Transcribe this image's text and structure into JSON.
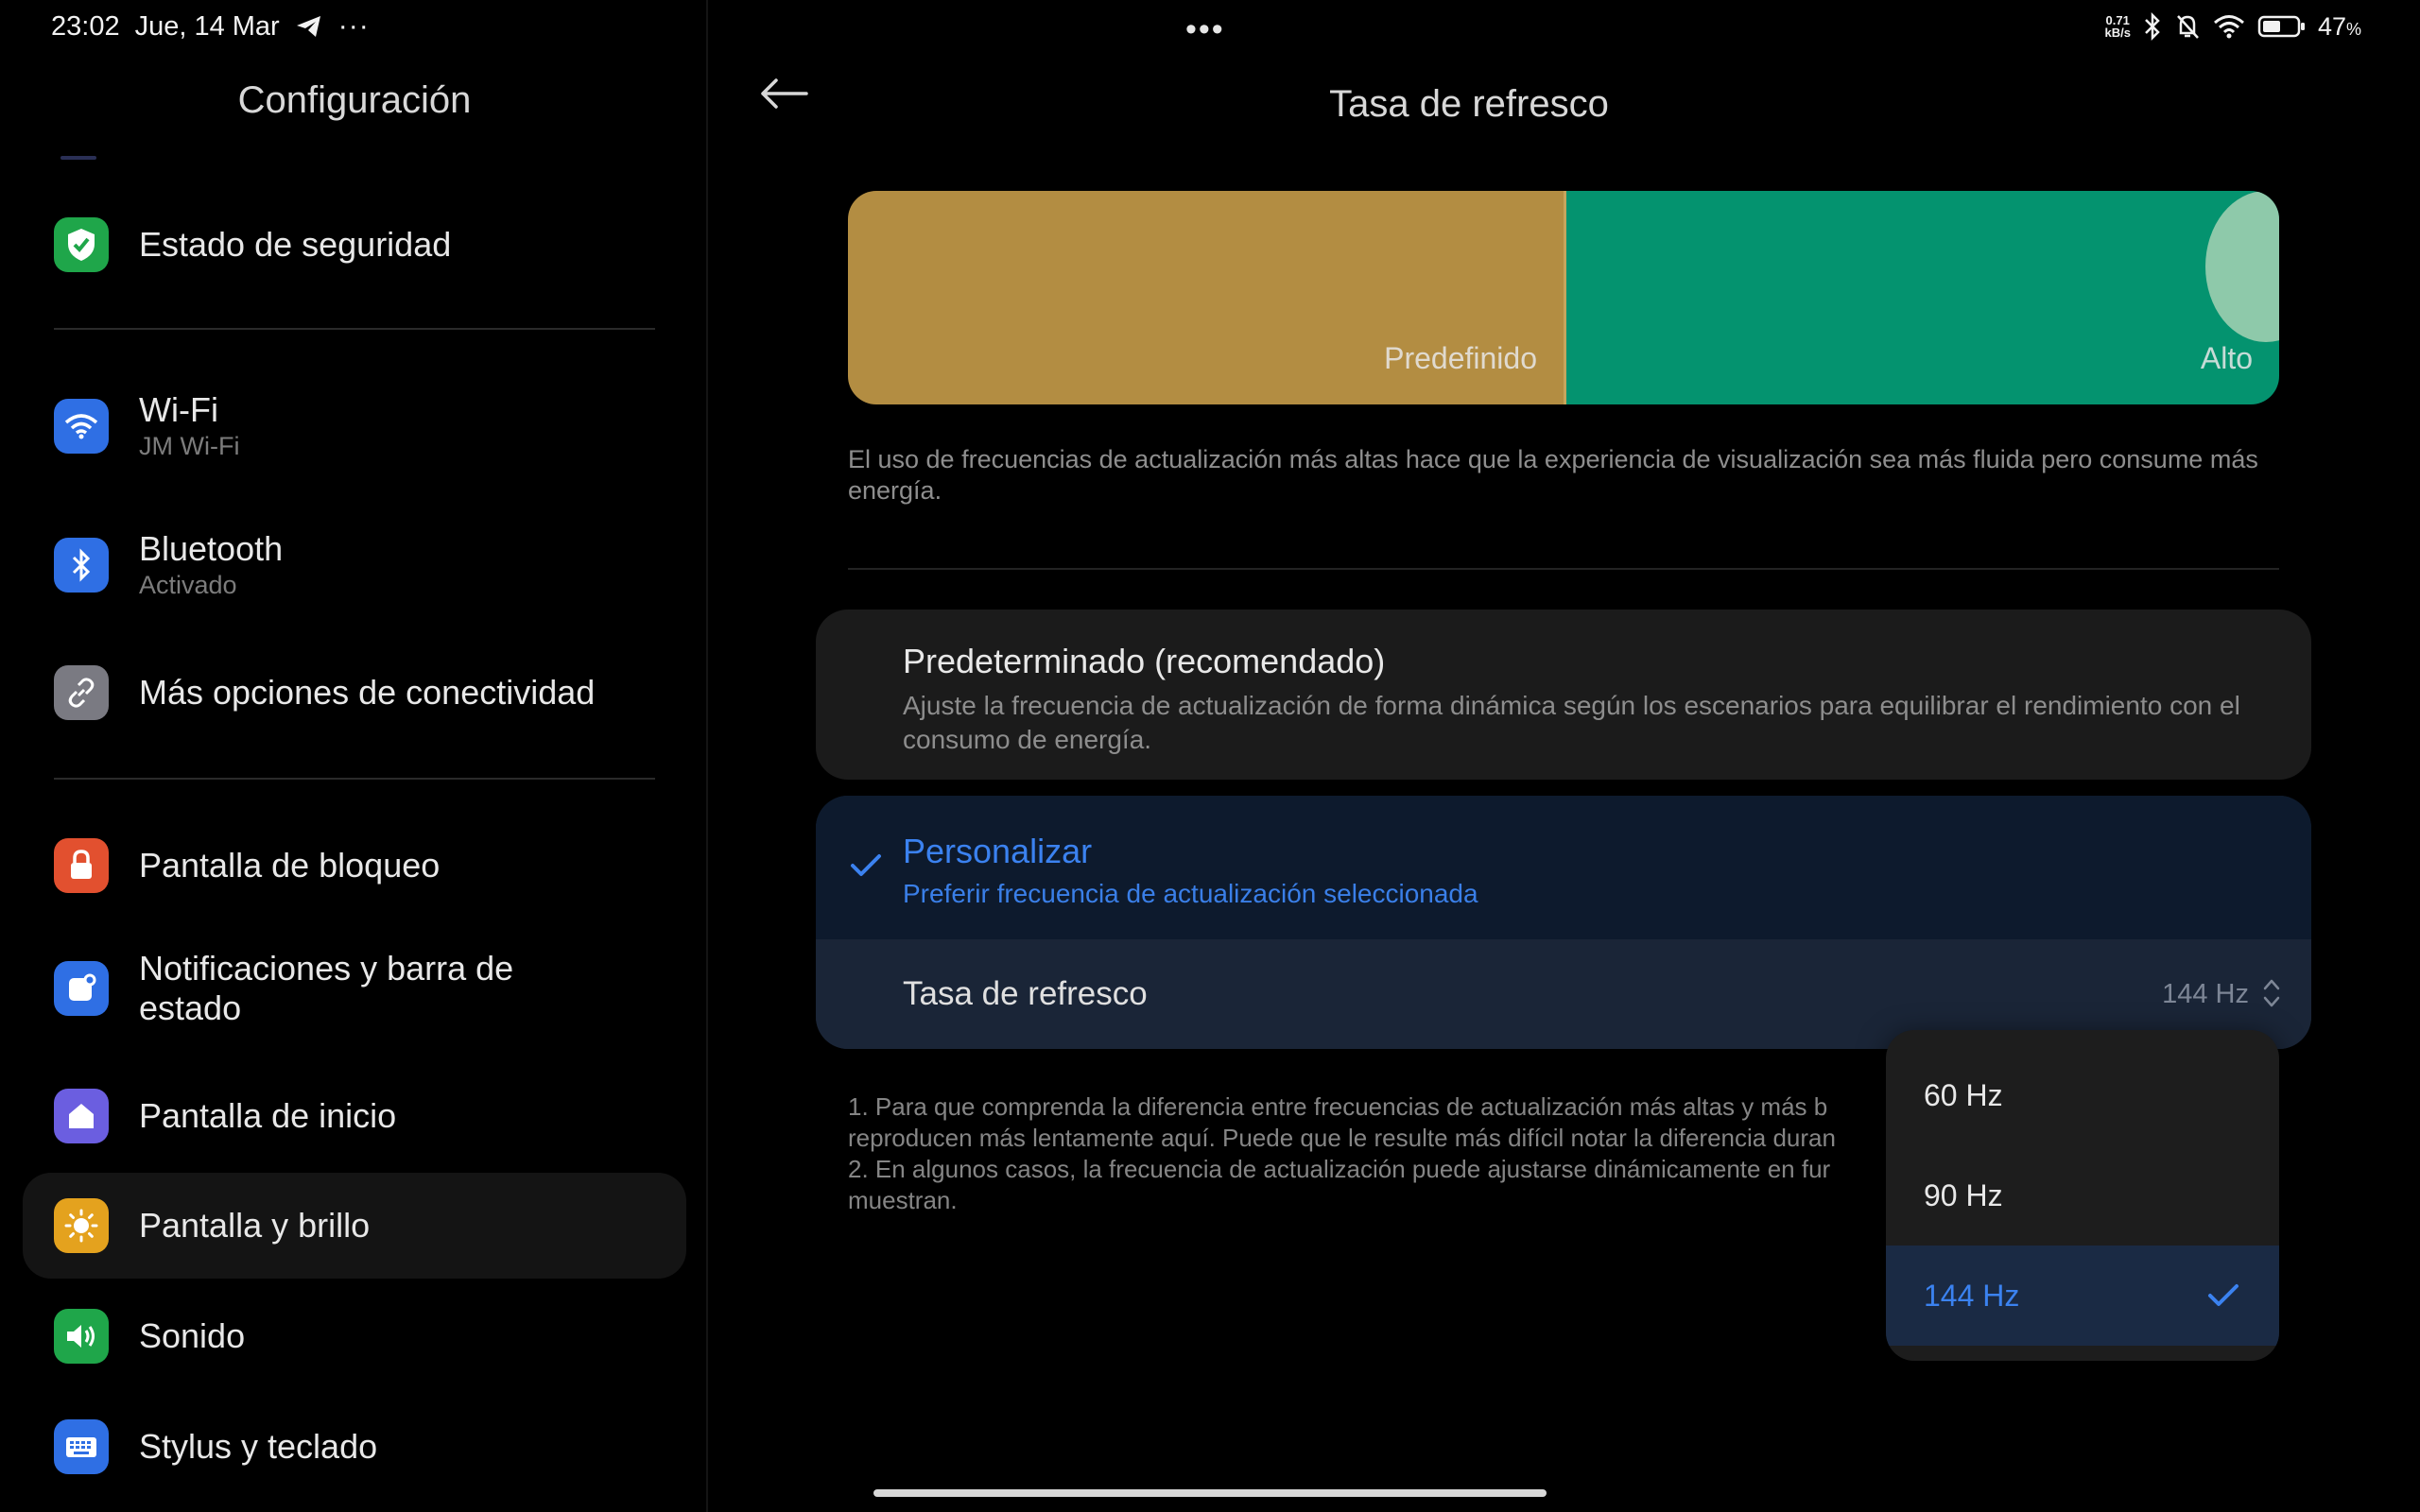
{
  "status": {
    "time": "23:02",
    "date": "Jue, 14 Mar",
    "netspeed_value": "0.71",
    "netspeed_unit": "kB/s",
    "battery": "47",
    "battery_unit": "%"
  },
  "sidebar": {
    "title": "Configuración",
    "items": [
      {
        "label": "Estado de seguridad",
        "sub": "",
        "icon": "shield-check-icon",
        "color": "#1fa64a"
      },
      {
        "label": "Wi-Fi",
        "sub": "JM Wi-Fi",
        "icon": "wifi-icon",
        "color": "#2f6fe4"
      },
      {
        "label": "Bluetooth",
        "sub": "Activado",
        "icon": "bluetooth-icon",
        "color": "#2f6fe4"
      },
      {
        "label": "Más opciones de conectividad",
        "sub": "",
        "icon": "link-icon",
        "color": "#7a7a82"
      },
      {
        "label": "Pantalla de bloqueo",
        "sub": "",
        "icon": "lock-icon",
        "color": "#e2502f"
      },
      {
        "label": "Notificaciones y barra de estado",
        "sub": "",
        "icon": "notification-icon",
        "color": "#2f6fe4"
      },
      {
        "label": "Pantalla de inicio",
        "sub": "",
        "icon": "home-icon",
        "color": "#6b5ee0"
      },
      {
        "label": "Pantalla y brillo",
        "sub": "",
        "icon": "sun-icon",
        "color": "#e4a21e"
      },
      {
        "label": "Sonido",
        "sub": "",
        "icon": "speaker-icon",
        "color": "#1fa64a"
      },
      {
        "label": "Stylus y teclado",
        "sub": "",
        "icon": "keyboard-icon",
        "color": "#2f6fe4"
      }
    ]
  },
  "page": {
    "title": "Tasa de refresco",
    "banner": {
      "left_label": "Predefinido",
      "right_label": "Alto",
      "left_color": "#b38d42",
      "right_color": "#04936f"
    },
    "description": "El uso de frecuencias de actualización más altas hace que la experiencia de visualización sea más fluida pero consume más energía.",
    "option_default": {
      "title": "Predeterminado (recomendado)",
      "sub": "Ajuste la frecuencia de actualización de forma dinámica según los escenarios para equilibrar el rendimiento con el consumo de energía."
    },
    "option_custom": {
      "title": "Personalizar",
      "sub": "Preferir frecuencia de actualización seleccionada",
      "selected": true
    },
    "rate_row": {
      "label": "Tasa de refresco",
      "value": "144 Hz"
    },
    "notes": [
      "1. Para que comprenda la diferencia entre frecuencias de actualización más altas y más b",
      "reproducen más lentamente aquí. Puede que le resulte más difícil notar la diferencia duran",
      "2. En algunos casos, la frecuencia de actualización puede ajustarse dinámicamente en fur",
      "muestran."
    ],
    "dropdown": {
      "options": [
        "60 Hz",
        "90 Hz",
        "144 Hz"
      ],
      "selected": "144 Hz"
    },
    "accent_color": "#3b82f0"
  }
}
